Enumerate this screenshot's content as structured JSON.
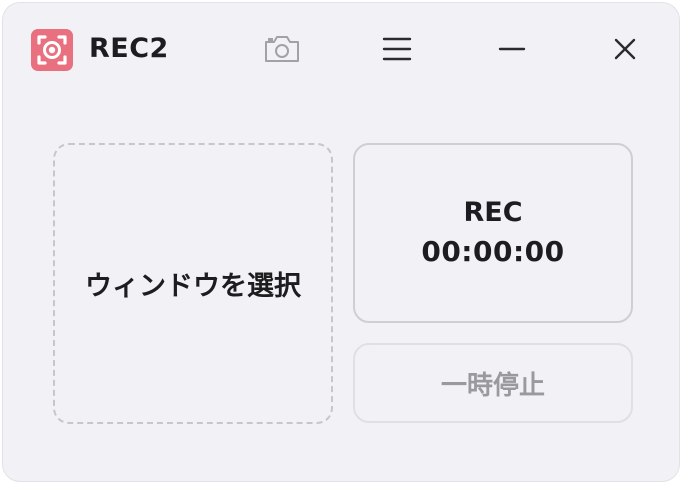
{
  "app": {
    "title": "REC2",
    "logo_icon": "record-frame-icon",
    "accent_color": "#e8707f"
  },
  "titlebar": {
    "camera_icon": "camera-icon",
    "menu_icon": "hamburger-menu-icon",
    "minimize_icon": "minimize-icon",
    "close_icon": "close-icon"
  },
  "main": {
    "select_window_label": "ウィンドウを選択",
    "rec_label": "REC",
    "rec_time": "00:00:00",
    "pause_label": "一時停止",
    "pause_enabled": false
  }
}
